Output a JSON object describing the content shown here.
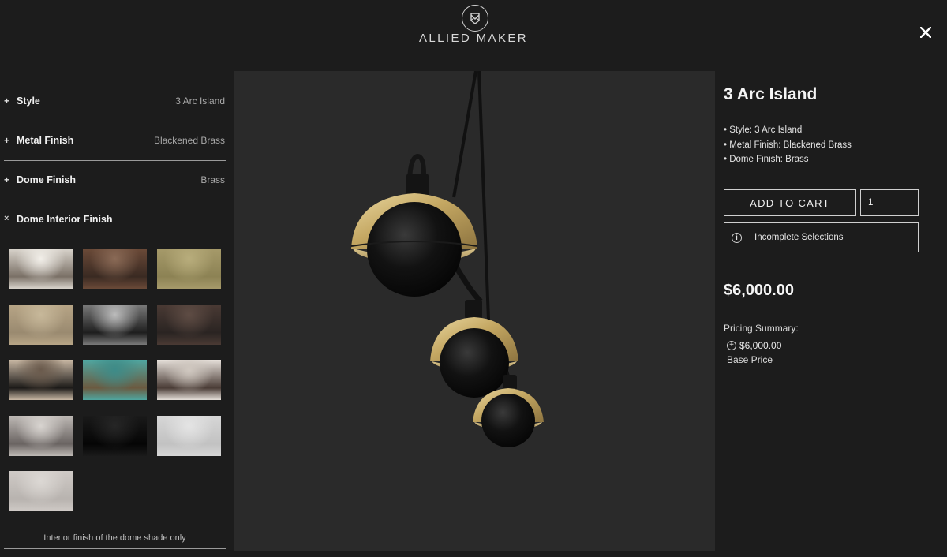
{
  "header": {
    "brand": "ALLIED MAKER",
    "logo_icon": "envelope-shield-icon",
    "close_icon": "close-icon"
  },
  "options": {
    "rows": [
      {
        "sign": "+",
        "label": "Style",
        "value": "3 Arc Island"
      },
      {
        "sign": "+",
        "label": "Metal Finish",
        "value": "Blackened Brass"
      },
      {
        "sign": "+",
        "label": "Dome Finish",
        "value": "Brass"
      }
    ],
    "open_section": {
      "sign": "×",
      "label": "Dome Interior Finish"
    },
    "swatch_note": "Interior finish of the dome shade only"
  },
  "swatches": [
    {
      "c1": "#d9d4cc",
      "c2": "#7a7066",
      "c3": "#f2efe9"
    },
    {
      "c1": "#6b4a38",
      "c2": "#3a2a22",
      "c3": "#8a6a56"
    },
    {
      "c1": "#a69a6a",
      "c2": "#8c8254",
      "c3": "#b8ad7c"
    },
    {
      "c1": "#b7a586",
      "c2": "#9a8a70",
      "c3": "#c7b89a"
    },
    {
      "c1": "#7a7a7a",
      "c2": "#1e1e1e",
      "c3": "#bcbcbc"
    },
    {
      "c1": "#4a3a34",
      "c2": "#2a2422",
      "c3": "#5e4c44"
    },
    {
      "c1": "#c9b8a4",
      "c2": "#1c1a18",
      "c3": "#6a5a4c"
    },
    {
      "c1": "#4fa6a0",
      "c2": "#6b5a40",
      "c3": "#3d8b88"
    },
    {
      "c1": "#e6e0da",
      "c2": "#4a3c36",
      "c3": "#d0c8c0"
    },
    {
      "c1": "#bdb8b4",
      "c2": "#6a6462",
      "c3": "#d8d4d0"
    },
    {
      "c1": "#1a1a1a",
      "c2": "#050505",
      "c3": "#262626"
    },
    {
      "c1": "#d6d6d6",
      "c2": "#c2c2c2",
      "c3": "#e4e4e4"
    },
    {
      "c1": "#cfcac6",
      "c2": "#b8b3af",
      "c3": "#dcd8d4"
    }
  ],
  "product": {
    "title": "3 Arc Island",
    "specs": [
      "• Style: 3 Arc Island",
      "• Metal Finish: Blackened Brass",
      "• Dome Finish: Brass"
    ],
    "add_to_cart": "ADD TO CART",
    "quantity": "1",
    "incomplete_label": "Incomplete Selections",
    "info_icon": "info-icon",
    "price": "$6,000.00",
    "pricing_summary_label": "Pricing Summary:",
    "base_price": "$6,000.00",
    "base_price_label": "Base Price",
    "plus_icon": "plus-circle-icon"
  },
  "colors": {
    "background": "#1c1c1c",
    "viewer_background": "#2a2a2a",
    "brass": "#c9ad6a",
    "dome_black": "#111111"
  }
}
